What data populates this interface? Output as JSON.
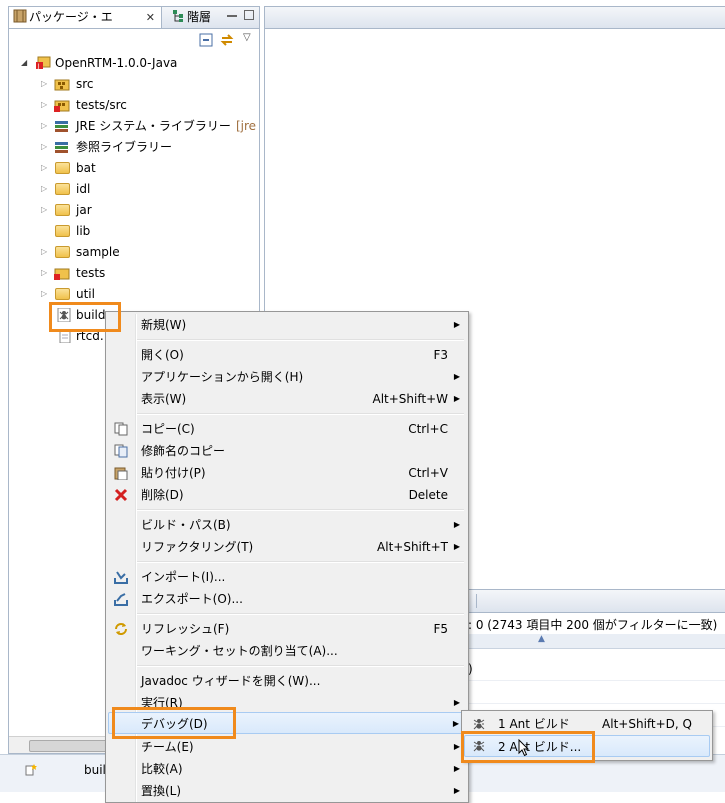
{
  "tabs": {
    "package_explorer": "パッケージ・エ",
    "hierarchy": "階層"
  },
  "tree": {
    "project": "OpenRTM-1.0.0-Java",
    "items": [
      {
        "label": "src",
        "suffix": ""
      },
      {
        "label": "tests/src",
        "suffix": ""
      },
      {
        "label": "JRE システム・ライブラリー",
        "suffix": "[jre"
      },
      {
        "label": "参照ライブラリー",
        "suffix": ""
      },
      {
        "label": "bat",
        "suffix": ""
      },
      {
        "label": "idl",
        "suffix": ""
      },
      {
        "label": "jar",
        "suffix": ""
      },
      {
        "label": "lib",
        "suffix": ""
      },
      {
        "label": "sample",
        "suffix": ""
      },
      {
        "label": "tests",
        "suffix": ""
      },
      {
        "label": "util",
        "suffix": ""
      },
      {
        "label": "build.",
        "suffix": ""
      },
      {
        "label": "rtcd.",
        "suffix": ""
      }
    ]
  },
  "problems": {
    "summary": ": 0 (2743 項目中 200 個がフィルターに一致)",
    "row1": ")"
  },
  "status_bar": {
    "label": "buil"
  },
  "context_menu": {
    "items": [
      {
        "label": "新規(W)",
        "shortcut": "",
        "arrow": "▶"
      },
      {
        "label": "開く(O)",
        "shortcut": "F3",
        "arrow": ""
      },
      {
        "label": "アプリケーションから開く(H)",
        "shortcut": "",
        "arrow": "▶"
      },
      {
        "label": "表示(W)",
        "shortcut": "Alt+Shift+W",
        "arrow": "▶"
      },
      {
        "label": "コピー(C)",
        "shortcut": "Ctrl+C",
        "arrow": ""
      },
      {
        "label": "修飾名のコピー",
        "shortcut": "",
        "arrow": ""
      },
      {
        "label": "貼り付け(P)",
        "shortcut": "Ctrl+V",
        "arrow": ""
      },
      {
        "label": "削除(D)",
        "shortcut": "Delete",
        "arrow": ""
      },
      {
        "label": "ビルド・パス(B)",
        "shortcut": "",
        "arrow": "▶"
      },
      {
        "label": "リファクタリング(T)",
        "shortcut": "Alt+Shift+T",
        "arrow": "▶"
      },
      {
        "label": "インポート(I)...",
        "shortcut": "",
        "arrow": ""
      },
      {
        "label": "エクスポート(O)...",
        "shortcut": "",
        "arrow": ""
      },
      {
        "label": "リフレッシュ(F)",
        "shortcut": "F5",
        "arrow": ""
      },
      {
        "label": "ワーキング・セットの割り当て(A)...",
        "shortcut": "",
        "arrow": ""
      },
      {
        "label": "Javadoc ウィザードを開く(W)...",
        "shortcut": "",
        "arrow": ""
      },
      {
        "label": "実行(R)",
        "shortcut": "",
        "arrow": "▶"
      },
      {
        "label": "デバッグ(D)",
        "shortcut": "",
        "arrow": "▶"
      },
      {
        "label": "チーム(E)",
        "shortcut": "",
        "arrow": "▶"
      },
      {
        "label": "比較(A)",
        "shortcut": "",
        "arrow": "▶"
      },
      {
        "label": "置換(L)",
        "shortcut": "",
        "arrow": "▶"
      }
    ]
  },
  "submenu": {
    "items": [
      {
        "label": "1 Ant ビルド",
        "shortcut": "Alt+Shift+D, Q"
      },
      {
        "label": "2 Ant ビルド...",
        "shortcut": ""
      }
    ]
  },
  "colors": {
    "highlight_box": "#f08a1c",
    "menu_bg": "#f0f0f0",
    "menu_hover": "#d9e9fb"
  }
}
